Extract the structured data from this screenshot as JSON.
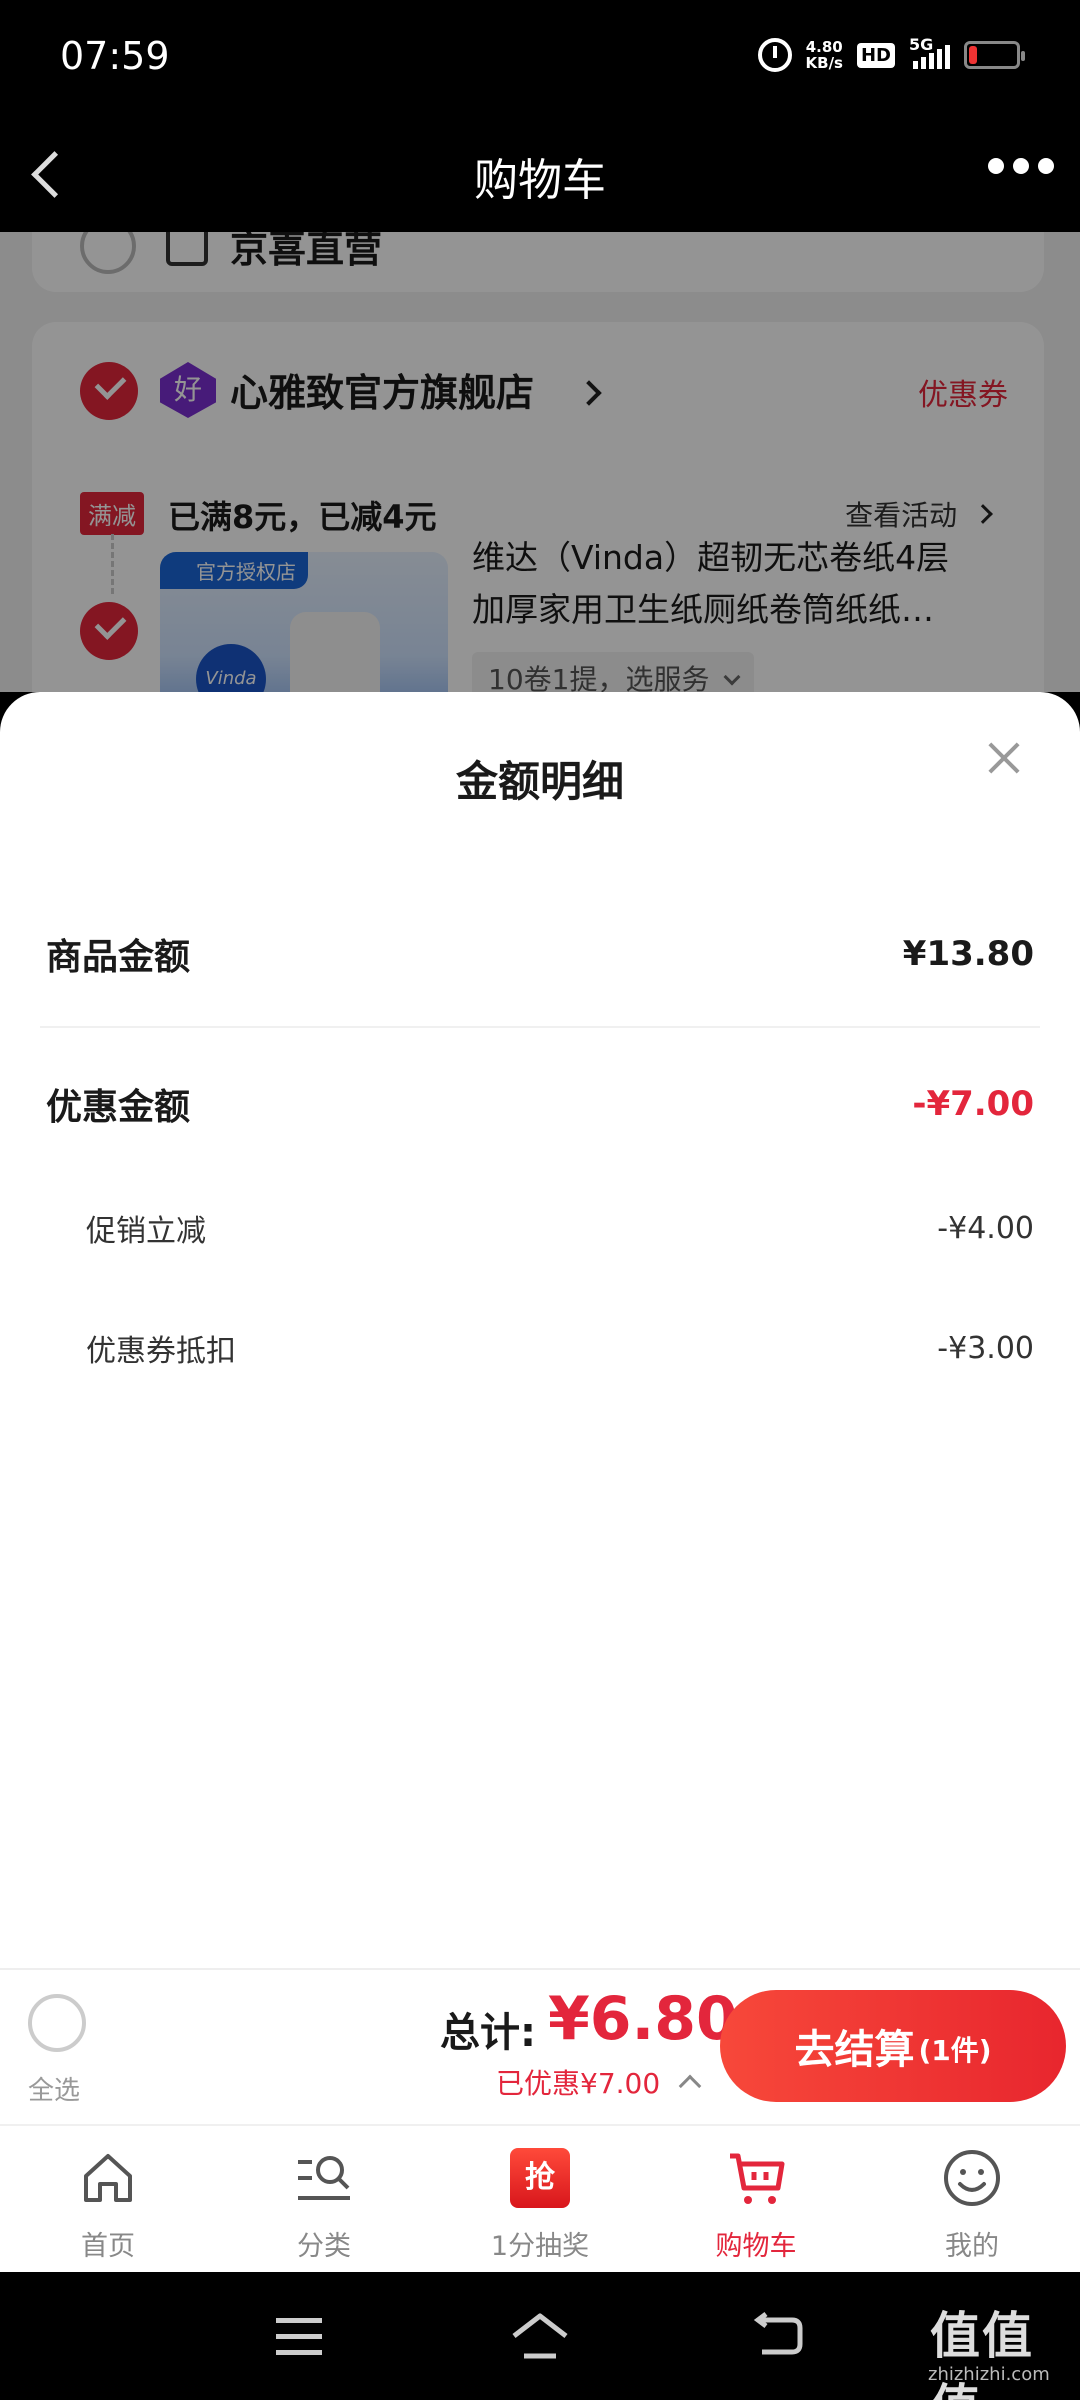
{
  "status_bar": {
    "time": "07:59",
    "net_speed_value": "4.80",
    "net_speed_unit": "KB/s",
    "hd": "HD",
    "network": "5G",
    "icons": [
      "alarm-icon",
      "signal-icon",
      "battery-icon"
    ],
    "battery_level": 0.15
  },
  "header": {
    "title": "购物车",
    "back_icon": "chevron-left-icon",
    "more_icon": "more-dots-icon"
  },
  "cart": {
    "store1": {
      "name": "京喜直营",
      "icon": "shop-icon"
    },
    "store2": {
      "badge": "好",
      "name": "心雅致官方旗舰店",
      "coupon_link": "优惠券",
      "promo_tag": "满减",
      "promo_text": "已满8元，已减4元",
      "promo_link": "查看活动",
      "product": {
        "auth_badge": "官方授权店",
        "brand": "Vinda",
        "title_line1": "维达（Vinda）超韧无芯卷纸4层",
        "title_line2": "加厚家用卫生纸厕纸卷筒纸纸…",
        "spec": "10卷1提，选服务"
      }
    }
  },
  "sheet": {
    "title": "金额明细",
    "rows": [
      {
        "label": "商品金额",
        "value": "¥13.80"
      },
      {
        "label": "优惠金额",
        "value": "-¥7.00"
      },
      {
        "label": "促销立减",
        "value": "-¥4.00"
      },
      {
        "label": "优惠券抵扣",
        "value": "-¥3.00"
      }
    ]
  },
  "checkout": {
    "select_all": "全选",
    "total_label": "总计:",
    "total_value": "¥6.80",
    "saved": "已优惠¥7.00",
    "button_main": "去结算",
    "button_count": "(1件)"
  },
  "tabs": [
    {
      "label": "首页",
      "icon": "home-icon"
    },
    {
      "label": "分类",
      "icon": "category-search-icon"
    },
    {
      "label": "1分抽奖",
      "icon": "lottery-icon",
      "icon_text": "抢"
    },
    {
      "label": "购物车",
      "icon": "cart-icon",
      "active": true
    },
    {
      "label": "我的",
      "icon": "profile-smile-icon"
    }
  ],
  "colors": {
    "accent": "#e3263c",
    "checkout_gradient_start": "#f7483a",
    "checkout_gradient_end": "#e8262e"
  },
  "watermark": {
    "logo": "值值值",
    "site": "zhizhizhi.com"
  }
}
